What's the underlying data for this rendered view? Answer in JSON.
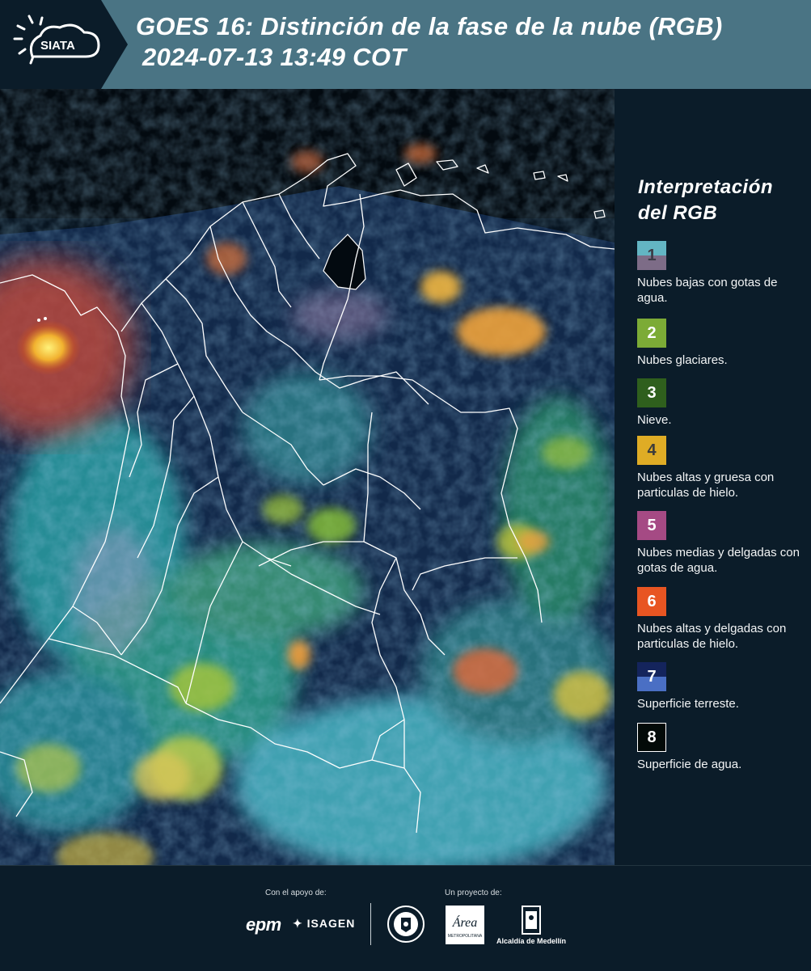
{
  "header": {
    "logo_text": "SIATA",
    "title_line1": "GOES 16: Distinción de la fase de la nube (RGB)",
    "title_line2": "2024-07-13 13:49 COT"
  },
  "legend": {
    "title": "Interpretación del RGB",
    "items": [
      {
        "number": "1",
        "label": "Nubes bajas con gotas de agua.",
        "color_top": "#63b5c3",
        "color_bottom": "#7d6c87",
        "num_color": "#3b3b46"
      },
      {
        "number": "2",
        "label": "Nubes glaciares.",
        "color_top": "#7cab36",
        "color_bottom": "#7cab36",
        "num_color": "#ffffff"
      },
      {
        "number": "3",
        "label": "Nieve.",
        "color_top": "#2f5f1d",
        "color_bottom": "#2f5f1d",
        "num_color": "#ffffff"
      },
      {
        "number": "4",
        "label": "Nubes altas y gruesa con particulas de hielo.",
        "color_top": "#dfac25",
        "color_bottom": "#dfac25",
        "num_color": "#3b3b3b"
      },
      {
        "number": "5",
        "label": "Nubes medias y delgadas con gotas de agua.",
        "color_top": "#a54a84",
        "color_bottom": "#a54a84",
        "num_color": "#ffffff"
      },
      {
        "number": "6",
        "label": "Nubes altas y delgadas con particulas de hielo.",
        "color_top": "#e85522",
        "color_bottom": "#e85522",
        "num_color": "#ffffff"
      },
      {
        "number": "7",
        "label": "Superficie terreste.",
        "color_top": "#14245c",
        "color_bottom": "#4a6fc4",
        "num_color": "#ffffff"
      },
      {
        "number": "8",
        "label": "Superficie de agua.",
        "color_top": "#030a08",
        "color_bottom": "#030a08",
        "num_color": "#ffffff"
      }
    ]
  },
  "footer": {
    "support_label": "Con el apoyo de:",
    "project_label": "Un proyecto de:",
    "epm": "epm",
    "isagen": "ISAGEN",
    "area_text": "Área",
    "area_sub": "METROPOLITANA",
    "alcaldia": "Alcaldía de Medellín"
  }
}
